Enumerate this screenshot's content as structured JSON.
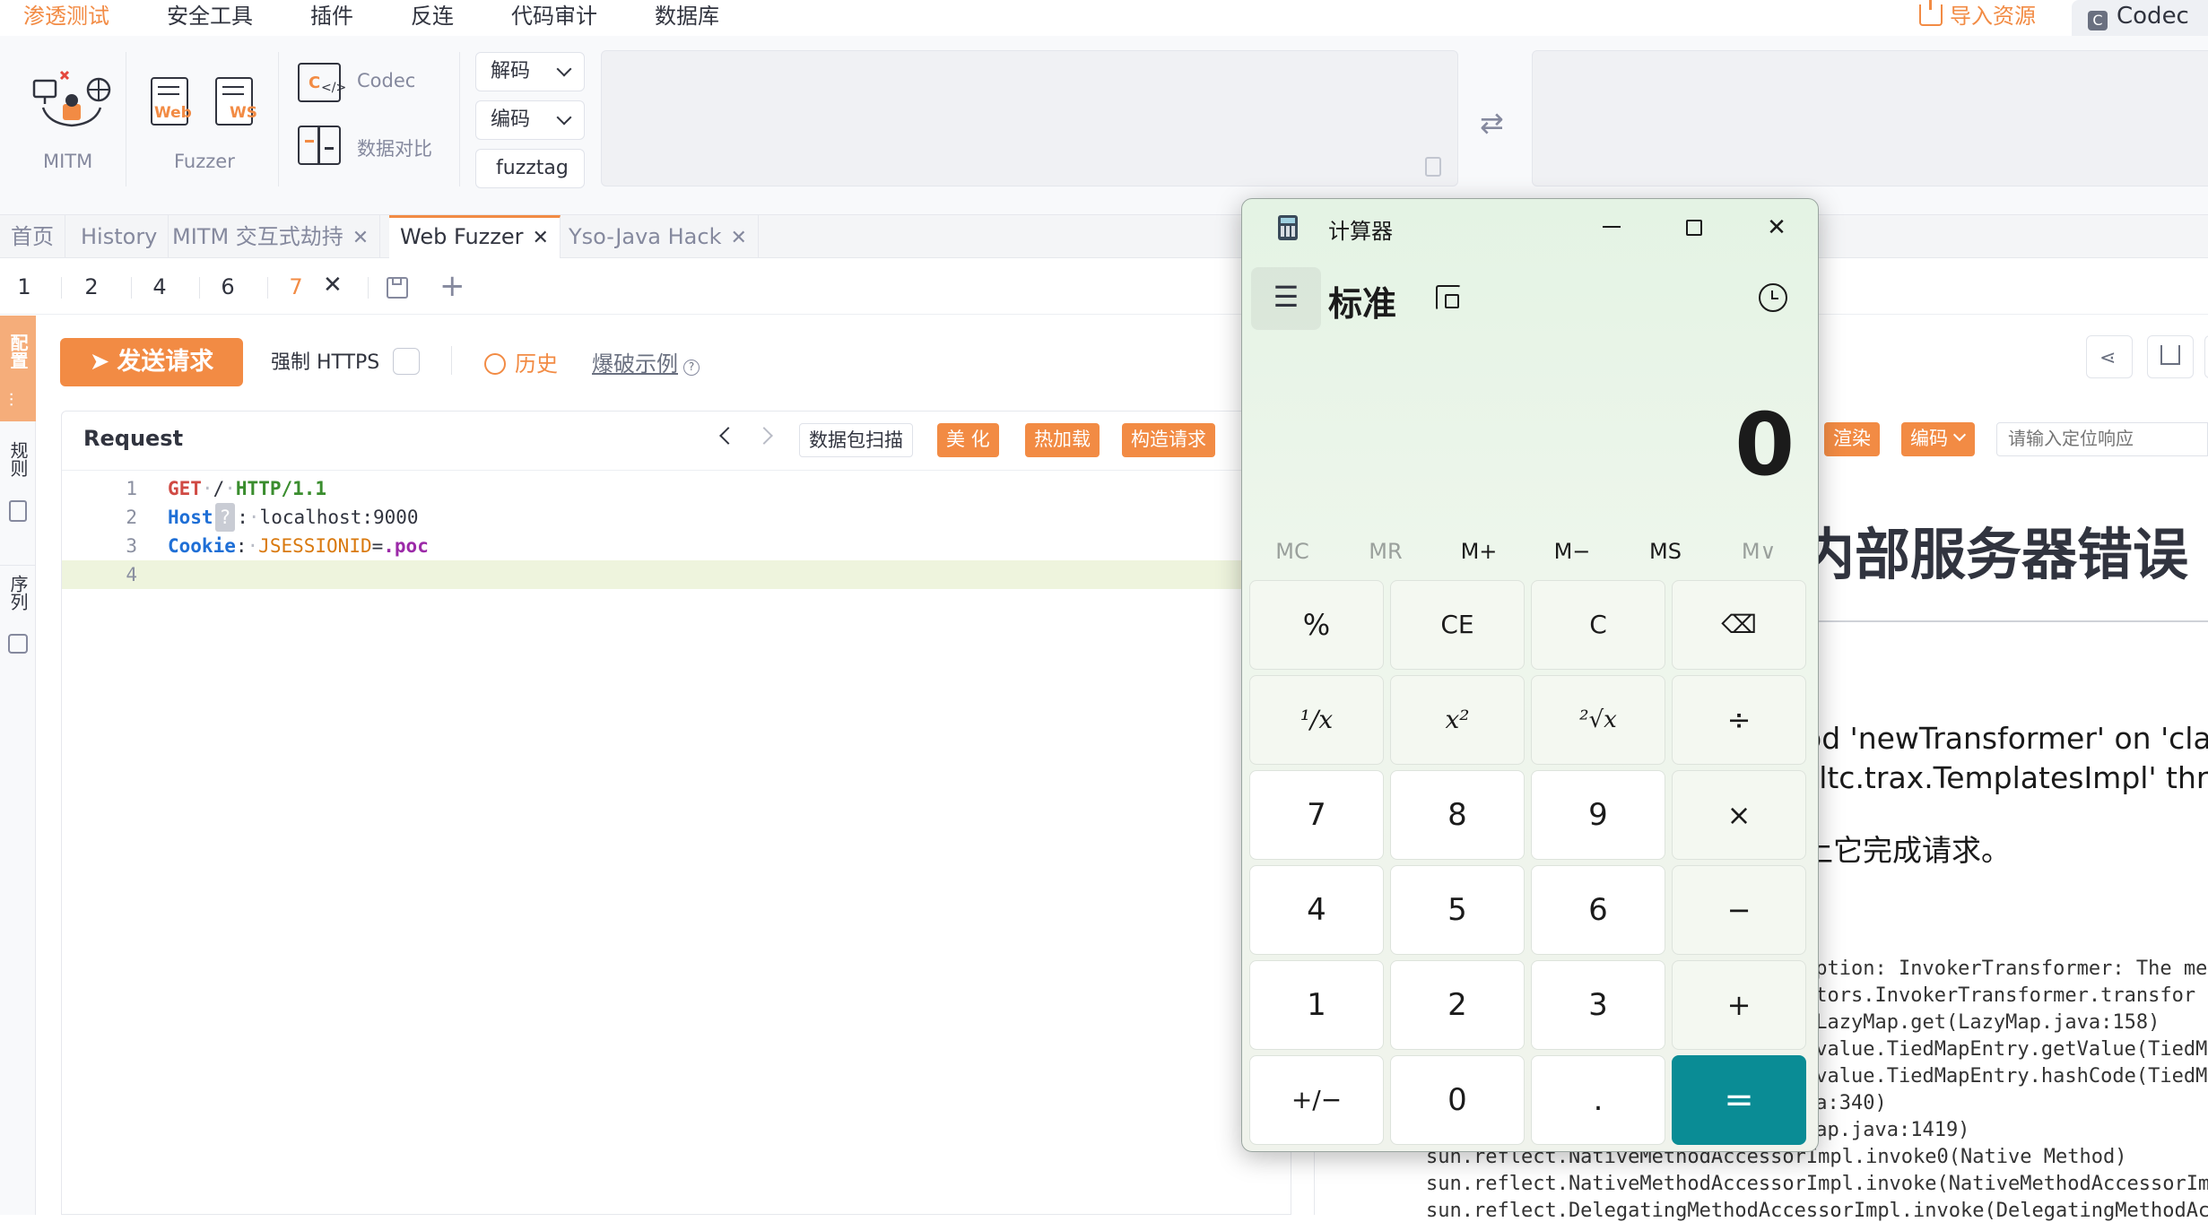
{
  "menu": [
    "渗透测试",
    "安全工具",
    "插件",
    "反连",
    "代码审计",
    "数据库"
  ],
  "import_label": "导入资源",
  "codec_tab": "Codec",
  "toolbar": {
    "mitm": "MITM",
    "fuzzer": "Fuzzer",
    "web_badge": "Web",
    "ws_badge": "WS",
    "codec": "Codec",
    "compare": "数据对比",
    "decode": "解码",
    "encode": "编码",
    "fuzztag": "fuzztag"
  },
  "tabs": [
    {
      "label": "首页",
      "closable": false
    },
    {
      "label": "History",
      "closable": false
    },
    {
      "label": "MITM 交互式劫持",
      "closable": true
    },
    {
      "label": "Web Fuzzer",
      "closable": true,
      "active": true
    },
    {
      "label": "Yso-Java Hack",
      "closable": true
    }
  ],
  "subtabs": [
    "1",
    "2",
    "4",
    "6",
    "7"
  ],
  "rail": [
    "配置",
    "规则",
    "序列"
  ],
  "fuzzer": {
    "send": "发送请求",
    "https": "强制 HTTPS",
    "history": "历史",
    "demo": "爆破示例"
  },
  "request": {
    "title": "Request",
    "scan": "数据包扫描",
    "beautify": "美 化",
    "hotload": "热加载",
    "build": "构造请求",
    "lines": [
      {
        "num": "1",
        "method": "GET",
        "path": "/",
        "proto": "HTTP/1.1"
      },
      {
        "num": "2",
        "header": "Host",
        "badge": "?",
        "value": "localhost:9000"
      },
      {
        "num": "3",
        "header": "Cookie",
        "key": "JSESSIONID",
        "val": ".poc"
      },
      {
        "num": "4"
      }
    ]
  },
  "response": {
    "render": "渲染",
    "encode": "编码",
    "search_placeholder": "请输入定位响应",
    "title": "内部服务器错误",
    "text1": "od 'newTransformer' on 'class",
    "text2": "sltc.trax.TemplatesImpl' threw",
    "text3": "上它完成请求。",
    "trace": [
      "eption: InvokerTransformer: The me",
      "ctors.InvokerTransformer.transfor",
      ".LazyMap.get(LazyMap.java:158)",
      "rvalue.TiedMapEntry.getValue(TiedM",
      "rvalue.TiedMapEntry.hashCode(TiedM",
      "va:340)",
      "Map.java:1419)",
      "sun.reflect.NativeMethodAccessorImpl.invoke0(Native Method)",
      "sun.reflect.NativeMethodAccessorImpl.invoke(NativeMethodAccessorImp",
      "sun.reflect.DelegatingMethodAccessorImpl.invoke(DelegatingMethodAcc"
    ]
  },
  "calculator": {
    "title": "计算器",
    "mode": "标准",
    "display": "0",
    "memory": [
      {
        "label": "MC",
        "enabled": false
      },
      {
        "label": "MR",
        "enabled": false
      },
      {
        "label": "M+",
        "enabled": true
      },
      {
        "label": "M−",
        "enabled": true
      },
      {
        "label": "MS",
        "enabled": true
      },
      {
        "label": "M∨",
        "enabled": false
      }
    ],
    "keys": [
      [
        "%",
        "CE",
        "C",
        "⌫"
      ],
      [
        "¹∕x",
        "x²",
        "²√x",
        "÷"
      ],
      [
        "7",
        "8",
        "9",
        "×"
      ],
      [
        "4",
        "5",
        "6",
        "−"
      ],
      [
        "1",
        "2",
        "3",
        "+"
      ],
      [
        "+/−",
        "0",
        ".",
        "="
      ]
    ]
  },
  "colors": {
    "accent": "#f28b44",
    "equals": "#0a8c95"
  }
}
